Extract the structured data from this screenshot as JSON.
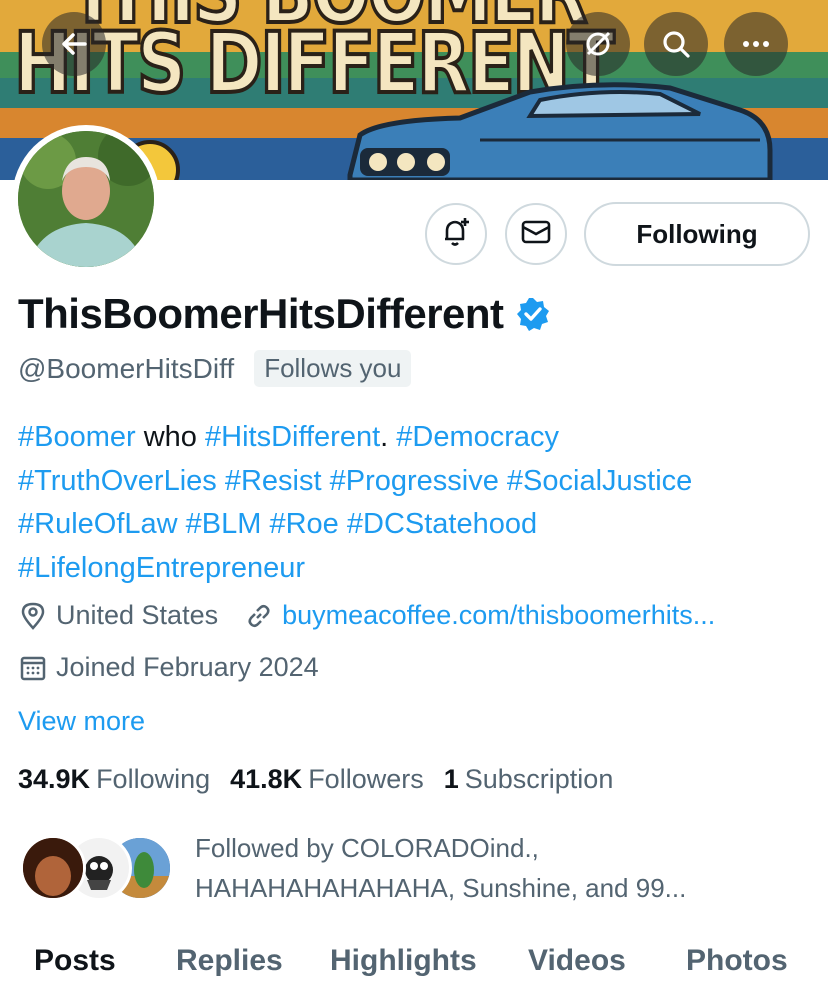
{
  "banner": {
    "line1_partial": "THIS BOOMER",
    "line2": "HITS DIFFERENT"
  },
  "icons": {
    "back": "arrow-left-icon",
    "translate": "no-translate-icon",
    "search": "search-icon",
    "more": "more-horizontal-icon",
    "notify": "bell-plus-icon",
    "message": "envelope-icon",
    "verified": "verified-badge-icon",
    "location": "location-pin-icon",
    "link": "link-icon",
    "calendar": "calendar-icon"
  },
  "colors": {
    "accent": "#1d9bf0",
    "text": "#0f1419",
    "muted": "#536471"
  },
  "profile": {
    "follow_button": "Following",
    "name": "ThisBoomerHitsDifferent",
    "handle": "@BoomerHitsDiff",
    "follows_you": "Follows you",
    "bio": {
      "t1": "#Boomer",
      "t2": " who ",
      "t3": "#HitsDifferent",
      "t4": ". ",
      "t5": "#Democracy",
      "t6": "#TruthOverLies",
      "t7": "#Resist",
      "t8": "#Progressive",
      "t9": "#SocialJustice",
      "t10": "#RuleOfLaw",
      "t11": "#BLM",
      "t12": "#Roe",
      "t13": "#DCStatehood",
      "t14": "#LifelongEntrepreneur"
    },
    "location": "United States",
    "website": "buymeacoffee.com/thisboomerhits...",
    "joined": "Joined February 2024",
    "view_more": "View more"
  },
  "stats": {
    "following_count": "34.9K",
    "following_label": "Following",
    "followers_count": "41.8K",
    "followers_label": "Followers",
    "subscription_count": "1",
    "subscription_label": "Subscription"
  },
  "followed_by": {
    "line1": "Followed by COLORADOind.,",
    "line2": "HAHAHAHAHAHAHA, Sunshine, and 99..."
  },
  "tabs": [
    "Posts",
    "Replies",
    "Highlights",
    "Videos",
    "Photos"
  ]
}
